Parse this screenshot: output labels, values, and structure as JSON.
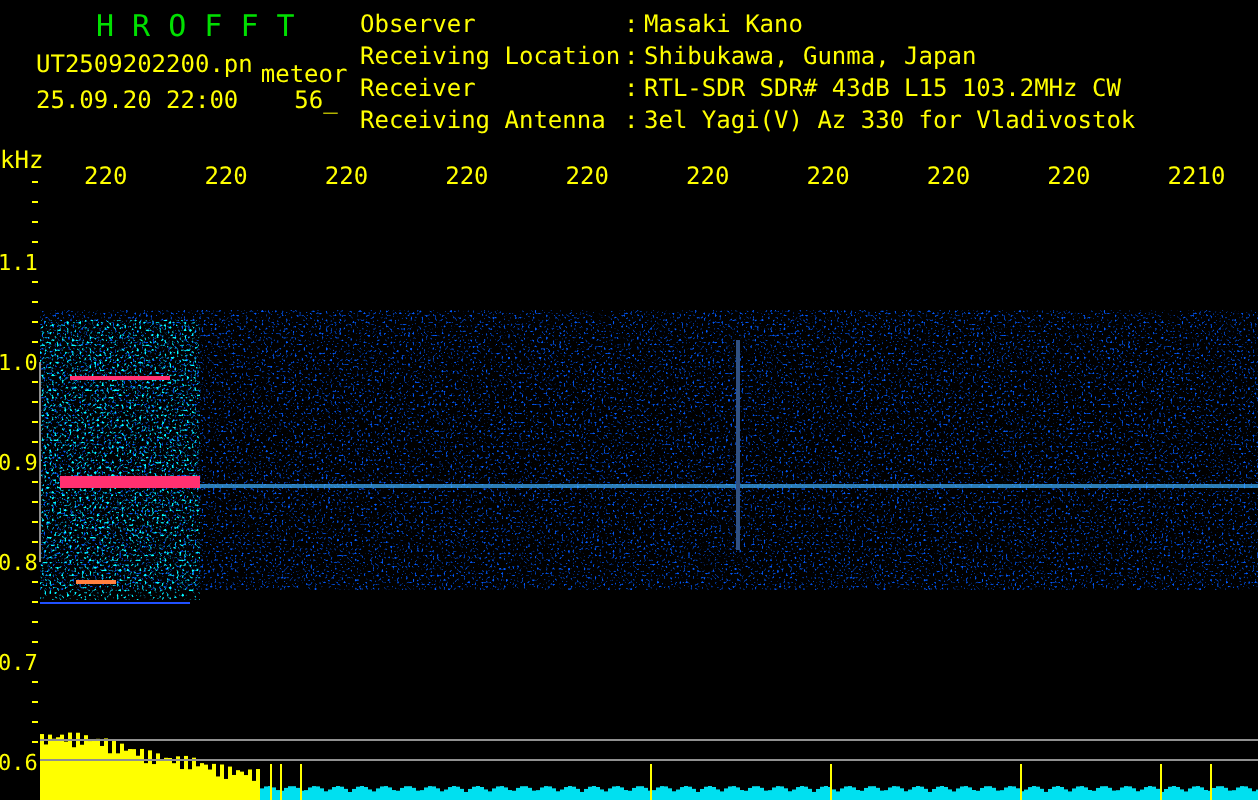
{
  "title": "H R O F F T",
  "file_name": "UT2509202200.pn",
  "mode": "meteor",
  "date_time": "25.09.20 22:00",
  "count": "56_",
  "info": [
    {
      "label": "Observer",
      "separator": ":",
      "value": "Masaki Kano"
    },
    {
      "label": "Receiving Location",
      "separator": ":",
      "value": "Shibukawa, Gunma, Japan"
    },
    {
      "label": "Receiver",
      "separator": ":",
      "value": "RTL-SDR SDR# 43dB L15 103.2MHz CW"
    },
    {
      "label": "Receiving Antenna",
      "separator": ":",
      "value": "3el Yagi(V) Az 330 for Vladivostok"
    }
  ],
  "plot": {
    "unit": "kHz",
    "x_labels": [
      "220",
      "220",
      "220",
      "220",
      "220",
      "220",
      "220",
      "220",
      "220",
      "2210"
    ],
    "y_labels": [
      "1.1",
      "1.0",
      "0.9",
      "0.8",
      "0.7",
      "0.6"
    ]
  }
}
